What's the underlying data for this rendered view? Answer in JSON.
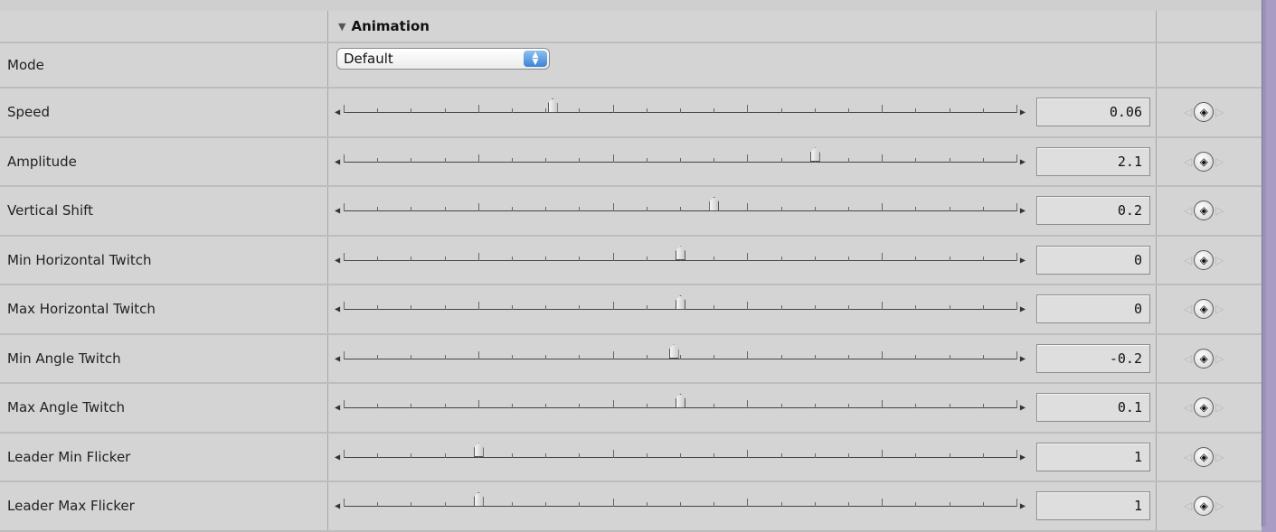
{
  "section": {
    "title": "Animation",
    "disclosure_icon": "triangle-down-icon"
  },
  "mode": {
    "label": "Mode",
    "value": "Default"
  },
  "parameters": [
    {
      "label": "Speed",
      "value": "0.06",
      "level": 0.31
    },
    {
      "label": " Amplitude",
      "value": "2.1",
      "level": 0.7
    },
    {
      "label": "Vertical Shift",
      "value": "0.2",
      "level": 0.55
    },
    {
      "label": "Min Horizontal Twitch",
      "value": "0",
      "level": 0.5
    },
    {
      "label": "Max Horizontal Twitch",
      "value": "0",
      "level": 0.5
    },
    {
      "label": "Min Angle Twitch",
      "value": "-0.2",
      "level": 0.49
    },
    {
      "label": "Max Angle Twitch",
      "value": "0.1",
      "level": 0.5
    },
    {
      "label": "Leader Min Flicker",
      "value": "1",
      "level": 0.2
    },
    {
      "label": "Leader Max Flicker",
      "value": "1",
      "level": 0.2
    }
  ],
  "icons": {
    "slider_left": "arrow-left-icon",
    "slider_right": "arrow-right-icon",
    "keyframe_prev": "previous-keyframe-icon",
    "keyframe_add": "add-keyframe-icon",
    "keyframe_next": "next-keyframe-icon",
    "popup_stepper": "up-down-stepper-icon"
  }
}
